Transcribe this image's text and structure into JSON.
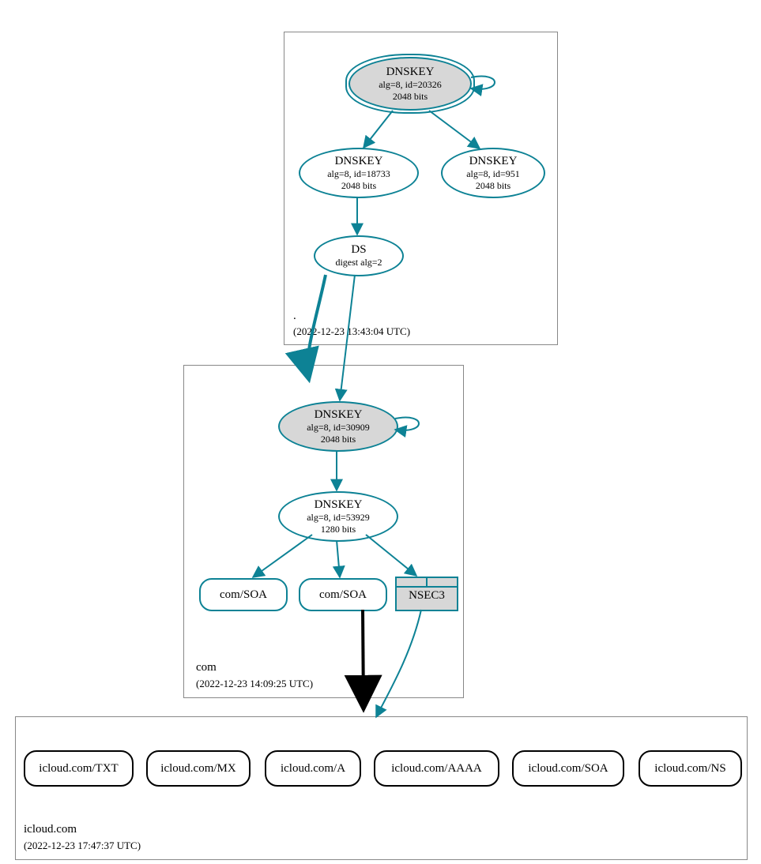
{
  "colors": {
    "teal": "#0d8295",
    "nodeFill": "#d7d7d7"
  },
  "zones": {
    "root": {
      "label": ".",
      "timestamp": "(2022-12-23 13:43:04 UTC)",
      "nodes": {
        "ksk": {
          "title": "DNSKEY",
          "line2": "alg=8, id=20326",
          "line3": "2048 bits"
        },
        "zsk1": {
          "title": "DNSKEY",
          "line2": "alg=8, id=18733",
          "line3": "2048 bits"
        },
        "zsk2": {
          "title": "DNSKEY",
          "line2": "alg=8, id=951",
          "line3": "2048 bits"
        },
        "ds": {
          "title": "DS",
          "line2": "digest alg=2"
        }
      }
    },
    "com": {
      "label": "com",
      "timestamp": "(2022-12-23 14:09:25 UTC)",
      "nodes": {
        "ksk": {
          "title": "DNSKEY",
          "line2": "alg=8, id=30909",
          "line3": "2048 bits"
        },
        "zsk": {
          "title": "DNSKEY",
          "line2": "alg=8, id=53929",
          "line3": "1280 bits"
        },
        "soa1": {
          "label": "com/SOA"
        },
        "soa2": {
          "label": "com/SOA"
        },
        "nsec3": {
          "label": "NSEC3"
        }
      }
    },
    "icloud": {
      "label": "icloud.com",
      "timestamp": "(2022-12-23 17:47:37 UTC)",
      "rrs": {
        "txt": "icloud.com/TXT",
        "mx": "icloud.com/MX",
        "a": "icloud.com/A",
        "aaaa": "icloud.com/AAAA",
        "soa": "icloud.com/SOA",
        "ns": "icloud.com/NS"
      }
    }
  }
}
